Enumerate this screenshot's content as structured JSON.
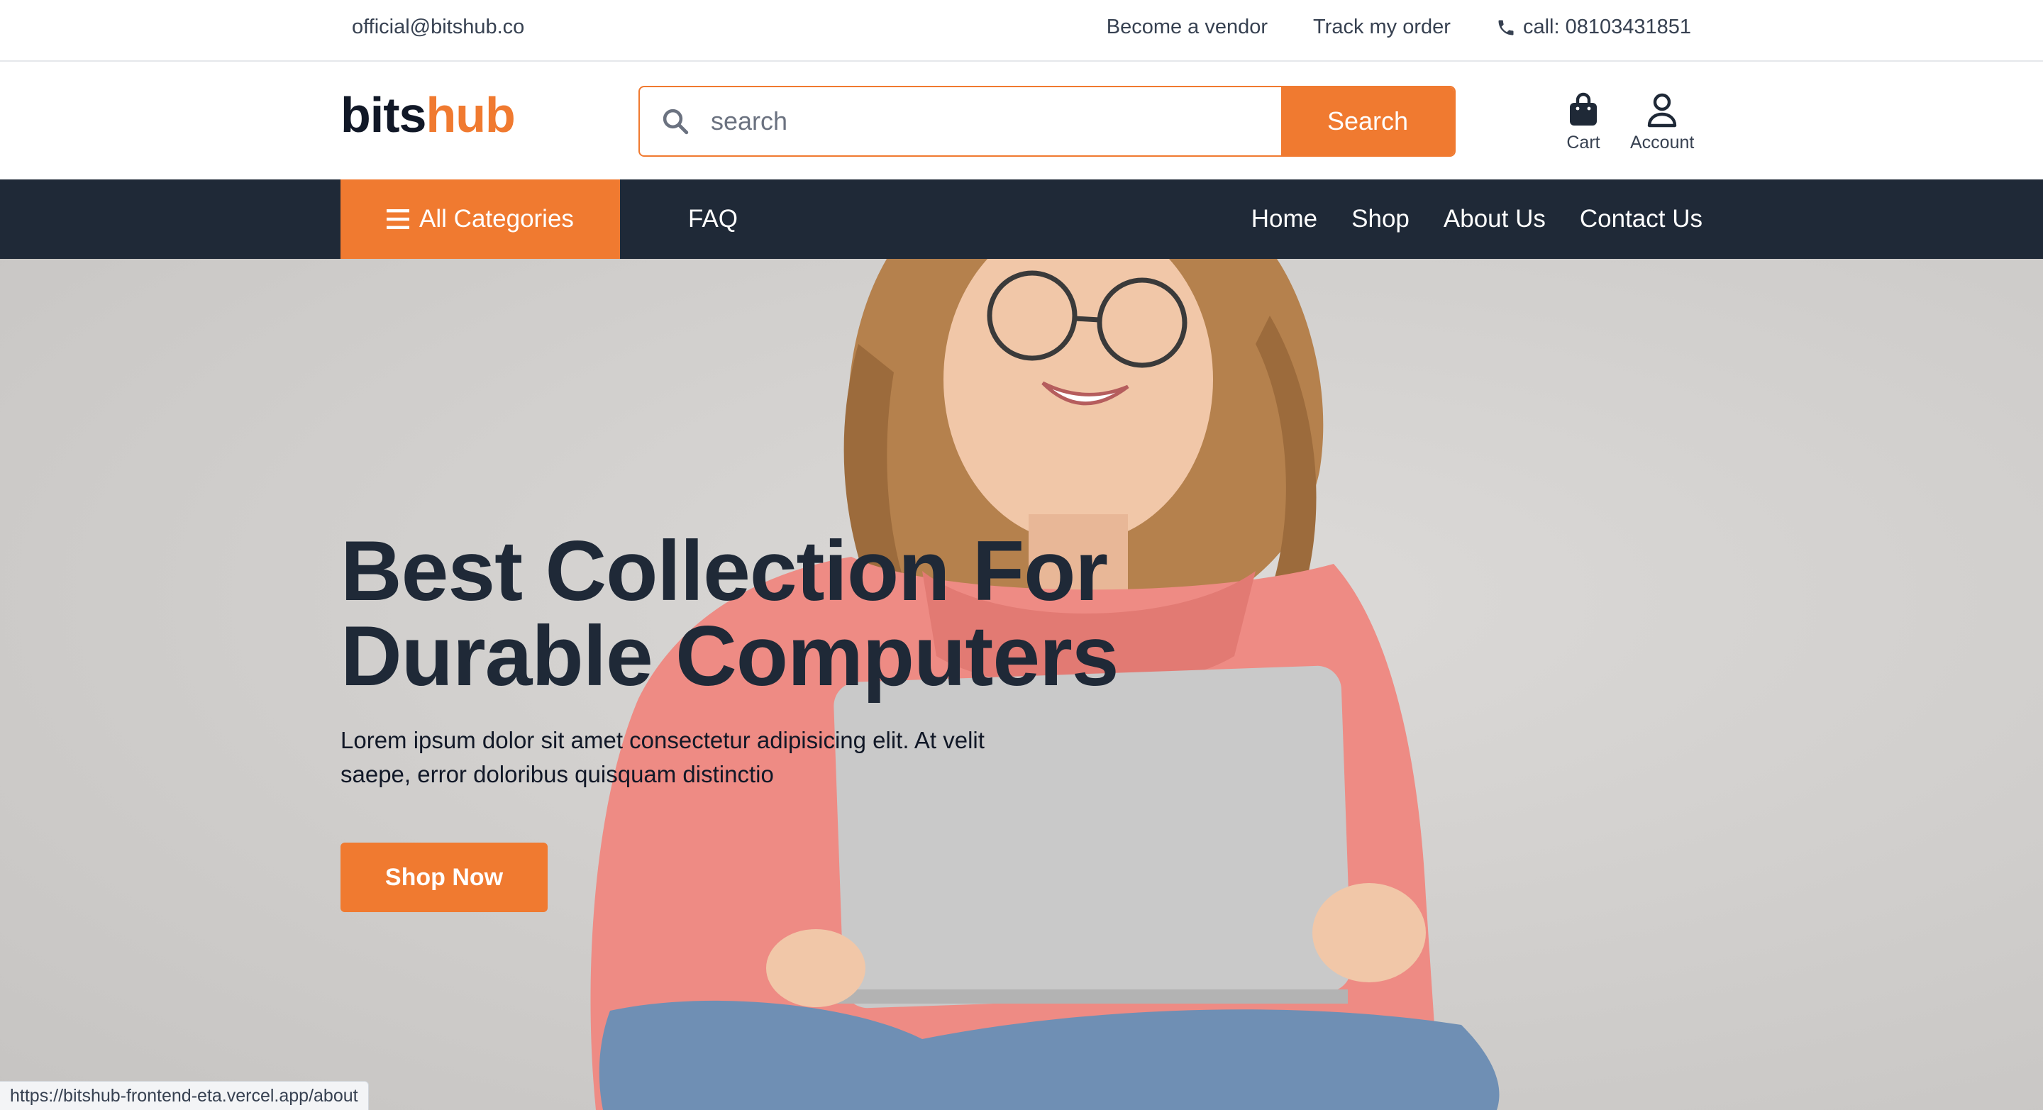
{
  "topbar": {
    "email": "official@bitshub.co",
    "become_vendor": "Become a vendor",
    "track_order": "Track my order",
    "call": "call: 08103431851"
  },
  "header": {
    "logo_part1": "bits",
    "logo_part2": "hub",
    "search_placeholder": "search",
    "search_button": "Search",
    "cart_label": "Cart",
    "account_label": "Account"
  },
  "nav": {
    "all_categories": "All Categories",
    "faq": "FAQ",
    "links": [
      "Home",
      "Shop",
      "About Us",
      "Contact Us"
    ]
  },
  "hero": {
    "title_line1": "Best Collection For",
    "title_line2": "Durable Computers",
    "text": "Lorem ipsum dolor sit amet consectetur adipisicing elit. At velit saepe, error doloribus quisquam distinctio",
    "button": "Shop Now"
  },
  "status": {
    "url": "https://bitshub-frontend-eta.vercel.app/about"
  },
  "colors": {
    "accent": "#f07a30",
    "nav_bg": "#1f2937",
    "text_dark": "#1f2937"
  },
  "icons": {
    "phone": "phone-icon",
    "search": "search-icon",
    "cart": "shopping-bag-icon",
    "account": "user-icon",
    "menu": "hamburger-menu-icon"
  }
}
